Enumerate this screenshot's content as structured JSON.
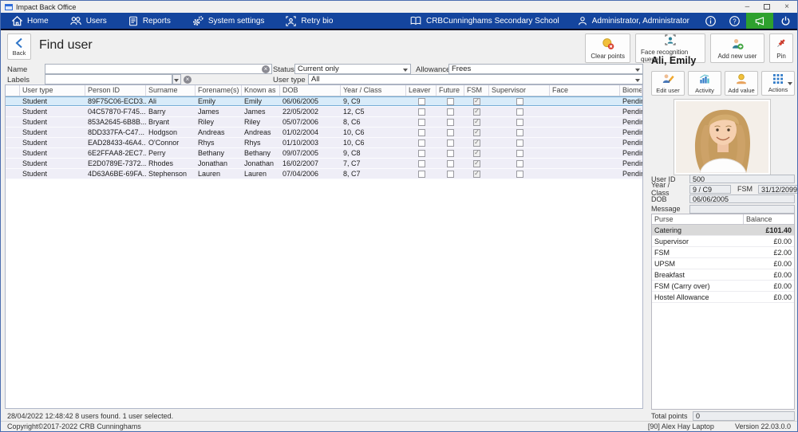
{
  "window": {
    "title": "Impact Back Office"
  },
  "nav": {
    "items": [
      {
        "label": "Home",
        "icon": "home-icon"
      },
      {
        "label": "Users",
        "icon": "users-icon"
      },
      {
        "label": "Reports",
        "icon": "reports-icon"
      },
      {
        "label": "System settings",
        "icon": "gears-icon"
      },
      {
        "label": "Retry bio",
        "icon": "biometric-scan-icon"
      }
    ],
    "school": "CRBCunninghams Secondary School",
    "user": "Administrator, Administrator",
    "right_icons": [
      "info-icon",
      "help-icon",
      "megaphone-icon",
      "power-icon"
    ]
  },
  "header": {
    "back_label": "Back",
    "title": "Find user",
    "buttons": [
      {
        "label": "Clear points",
        "icon": "clear-points-icon"
      },
      {
        "label": "Face recognition queue",
        "icon": "face-recognition-icon"
      },
      {
        "label": "Add new user",
        "icon": "add-user-icon"
      },
      {
        "label": "Pin",
        "icon": "pin-icon"
      }
    ]
  },
  "filters": {
    "name_label": "Name",
    "name_value": "",
    "labels_label": "Labels",
    "labels_value": "",
    "status_label": "Status",
    "status_value": "Current only",
    "allowance_label": "Allowance",
    "allowance_value": "Frees",
    "usertype_label": "User type",
    "usertype_value": "All"
  },
  "grid": {
    "columns": [
      "User type",
      "Person ID",
      "Surname",
      "Forename(s)",
      "Known as",
      "DOB",
      "Year / Class",
      "Leaver",
      "Future",
      "FSM",
      "Supervisor",
      "Face",
      "Biometric Permission"
    ],
    "rows": [
      {
        "user_type": "Student",
        "person_id": "89F75C06-ECD3...",
        "surname": "Ali",
        "forenames": "Emily",
        "known_as": "Emily",
        "dob": "06/06/2005",
        "year_class": "9, C9",
        "leaver": false,
        "future": false,
        "fsm": true,
        "supervisor": false,
        "face": "",
        "biometric": "Pending"
      },
      {
        "user_type": "Student",
        "person_id": "04C57870-F745...",
        "surname": "Barry",
        "forenames": "James",
        "known_as": "James",
        "dob": "22/05/2002",
        "year_class": "12, C5",
        "leaver": false,
        "future": false,
        "fsm": true,
        "supervisor": false,
        "face": "",
        "biometric": "Pending"
      },
      {
        "user_type": "Student",
        "person_id": "853A2645-6B8B...",
        "surname": "Bryant",
        "forenames": "Riley",
        "known_as": "Riley",
        "dob": "05/07/2006",
        "year_class": "8, C6",
        "leaver": false,
        "future": false,
        "fsm": true,
        "supervisor": false,
        "face": "",
        "biometric": "Pending"
      },
      {
        "user_type": "Student",
        "person_id": "8DD337FA-C47...",
        "surname": "Hodgson",
        "forenames": "Andreas",
        "known_as": "Andreas",
        "dob": "01/02/2004",
        "year_class": "10, C6",
        "leaver": false,
        "future": false,
        "fsm": true,
        "supervisor": false,
        "face": "",
        "biometric": "Pending"
      },
      {
        "user_type": "Student",
        "person_id": "EAD28433-46A4...",
        "surname": "O'Connor",
        "forenames": "Rhys",
        "known_as": "Rhys",
        "dob": "01/10/2003",
        "year_class": "10, C6",
        "leaver": false,
        "future": false,
        "fsm": true,
        "supervisor": false,
        "face": "",
        "biometric": "Pending"
      },
      {
        "user_type": "Student",
        "person_id": "6E2FFAA8-2EC7...",
        "surname": "Perry",
        "forenames": "Bethany",
        "known_as": "Bethany",
        "dob": "09/07/2005",
        "year_class": "9, C8",
        "leaver": false,
        "future": false,
        "fsm": true,
        "supervisor": false,
        "face": "",
        "biometric": "Pending"
      },
      {
        "user_type": "Student",
        "person_id": "E2D0789E-7372...",
        "surname": "Rhodes",
        "forenames": "Jonathan",
        "known_as": "Jonathan",
        "dob": "16/02/2007",
        "year_class": "7, C7",
        "leaver": false,
        "future": false,
        "fsm": true,
        "supervisor": false,
        "face": "",
        "biometric": "Pending"
      },
      {
        "user_type": "Student",
        "person_id": "4D63A6BE-69FA...",
        "surname": "Stephenson",
        "forenames": "Lauren",
        "known_as": "Lauren",
        "dob": "07/04/2006",
        "year_class": "8, C7",
        "leaver": false,
        "future": false,
        "fsm": true,
        "supervisor": false,
        "face": "",
        "biometric": "Pending"
      }
    ]
  },
  "status_bar": "28/04/2022 12:48:42 8 users found. 1 user selected.",
  "detail": {
    "name": "Ali, Emily",
    "buttons": [
      {
        "label": "Edit user",
        "icon": "edit-user-icon"
      },
      {
        "label": "Activity",
        "icon": "activity-chart-icon"
      },
      {
        "label": "Add value",
        "icon": "add-value-icon"
      },
      {
        "label": "Actions",
        "icon": "actions-grid-icon"
      }
    ],
    "fields": {
      "user_id_label": "User ID",
      "user_id": "500",
      "year_class_label": "Year / Class",
      "year_class": "9 / C9",
      "fsm_label": "FSM",
      "fsm_date": "31/12/2099",
      "dob_label": "DOB",
      "dob": "06/06/2005",
      "message_label": "Message",
      "message": ""
    },
    "purse": {
      "columns": [
        "Purse",
        "Balance"
      ],
      "rows": [
        [
          "Catering",
          "£101.40"
        ],
        [
          "Supervisor",
          "£0.00"
        ],
        [
          "FSM",
          "£2.00"
        ],
        [
          "UPSM",
          "£0.00"
        ],
        [
          "Breakfast",
          "£0.00"
        ],
        [
          "FSM (Carry over)",
          "£0.00"
        ],
        [
          "Hostel Allowance",
          "£0.00"
        ]
      ]
    },
    "total_points_label": "Total points",
    "total_points": "0"
  },
  "footer": {
    "copyright": "Copyright©2017-2022 CRB Cunninghams",
    "machine": "[90] Alex Hay Laptop",
    "version": "Version 22.03.0.0"
  },
  "colors": {
    "nav_blue": "#14459e",
    "announce_green": "#2ea12e",
    "selected_row": "#d8ebf9"
  }
}
